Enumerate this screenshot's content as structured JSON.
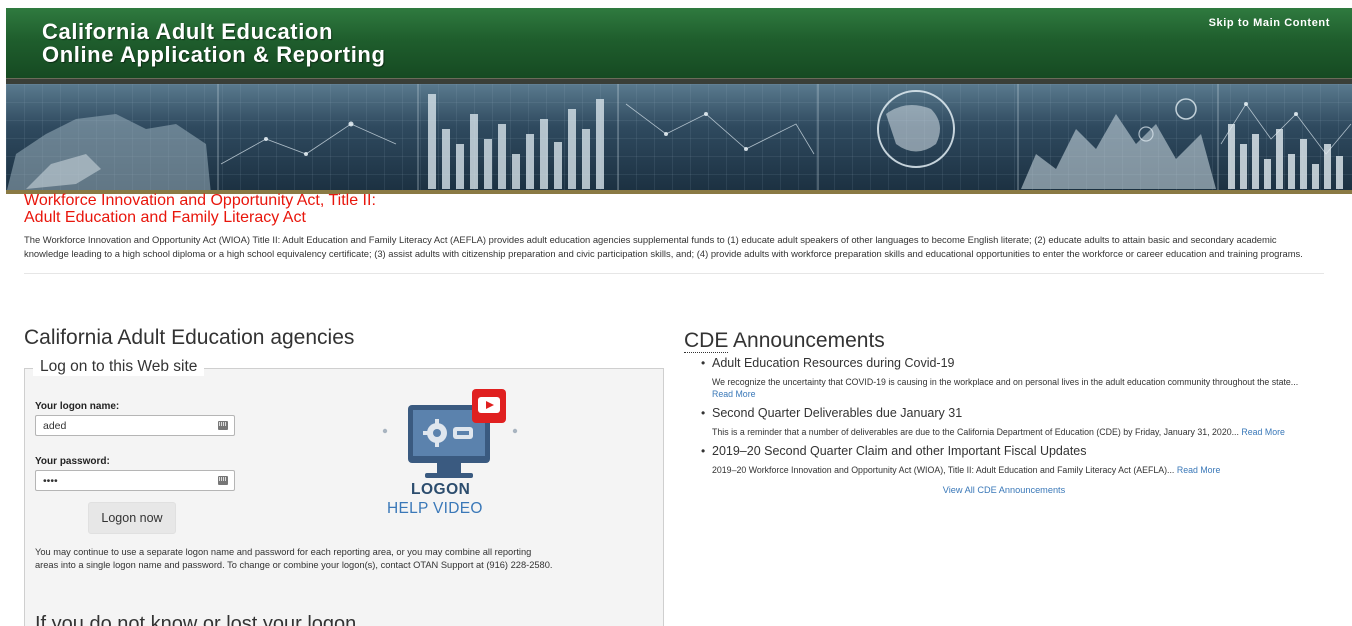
{
  "header": {
    "title_line1": "California Adult Education",
    "title_line2": "Online Application & Reporting",
    "skip_link": "Skip to Main Content"
  },
  "wioa": {
    "title_line1": "Workforce Innovation and Opportunity Act, Title II:",
    "title_line2": "Adult Education and Family Literacy Act",
    "description": "The Workforce Innovation and Opportunity Act (WIOA) Title II: Adult Education and Family Literacy Act (AEFLA) provides adult education agencies supplemental funds to (1) educate adult speakers of other languages to become English literate; (2) educate adults to attain basic and secondary academic knowledge leading to a high school diploma or a high school equivalency certificate; (3) assist adults with citizenship preparation and civic participation skills, and; (4) provide adults with workforce preparation skills and educational opportunities to enter the workforce or career education and training programs."
  },
  "login": {
    "section_title": "California Adult Education agencies",
    "legend": "Log on to this Web site",
    "username_label": "Your logon name:",
    "username_value": "aded",
    "password_label": "Your password:",
    "password_value": "••••",
    "submit_label": "Logon now",
    "help_line1": "LOGON",
    "help_line2": "HELP VIDEO",
    "note": "You may continue to use a separate logon name and password for each reporting area, or you may combine all reporting areas into a single logon name and password. To change or combine your logon(s), contact OTAN Support at (916) 228-2580.",
    "lost_title": "If you do not know or lost your logon"
  },
  "announcements": {
    "title_abbr": "CDE",
    "title_rest": " Announcements",
    "items": [
      {
        "title": "Adult Education Resources during Covid-19",
        "body": "We recognize the uncertainty that COVID-19 is causing in the workplace and on personal lives in the adult education community throughout the state...",
        "link": "Read More"
      },
      {
        "title": "Second Quarter Deliverables due January 31",
        "body": "This is a reminder that a number of deliverables are due to the California Department of Education (CDE) by Friday, January 31, 2020...",
        "link": "Read More"
      },
      {
        "title": "2019–20 Second Quarter Claim and other Important Fiscal Updates",
        "body": "2019–20 Workforce Innovation and Opportunity Act (WIOA), Title II: Adult Education and Family Literacy Act (AEFLA)...",
        "link": "Read More"
      }
    ],
    "view_all": "View All CDE Announcements"
  }
}
